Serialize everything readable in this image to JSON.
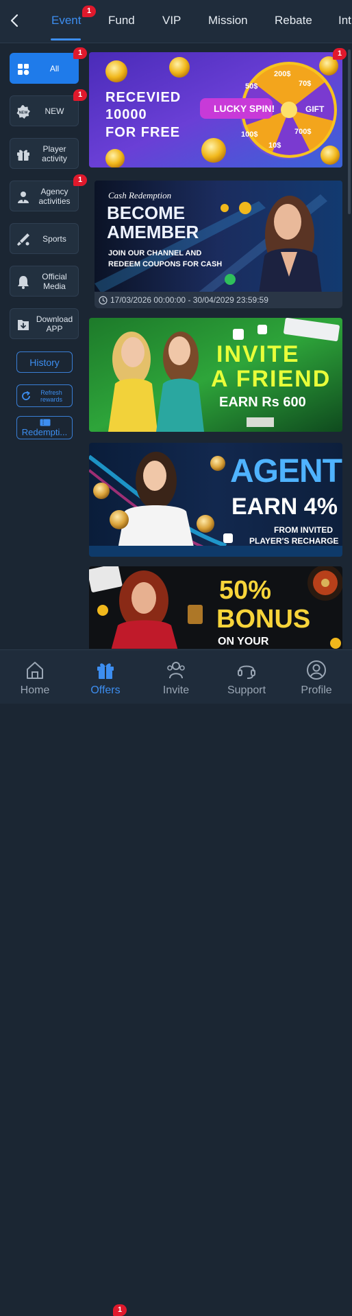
{
  "header": {
    "back_icon": "chevron-left-icon",
    "tabs": [
      {
        "label": "Event",
        "active": true,
        "badge": "1"
      },
      {
        "label": "Fund"
      },
      {
        "label": "VIP"
      },
      {
        "label": "Mission"
      },
      {
        "label": "Rebate"
      },
      {
        "label": "Int"
      }
    ]
  },
  "sidebar": {
    "items": [
      {
        "label": "All",
        "icon": "grid-icon",
        "active": true,
        "badge": "1"
      },
      {
        "label": "NEW",
        "icon": "new-icon",
        "badge": "1",
        "icon_text": "NEW"
      },
      {
        "label": "Player activity",
        "icon": "gift-icon"
      },
      {
        "label": "Agency activities",
        "icon": "agent-icon",
        "badge": "1"
      },
      {
        "label": "Sports",
        "icon": "sports-icon"
      },
      {
        "label": "Official Media",
        "icon": "bell-icon"
      },
      {
        "label": "Download APP",
        "icon": "download-icon"
      }
    ],
    "history_label": "History",
    "refresh_label": "Refresh rewards",
    "redemption_label": "Redempti..."
  },
  "banners": {
    "spin": {
      "badge": "1",
      "line1": "RECEVIED",
      "line2": "10000",
      "line3": "FOR FREE",
      "center_label": "LUCKY SPIN!",
      "wheel_labels": [
        "200$",
        "70$",
        "GIFT",
        "700$",
        "10$",
        "100$",
        "50$"
      ]
    },
    "member": {
      "script": "Cash Redemption",
      "line1": "BECOME",
      "line2": "AMEMBER",
      "line3": "JOIN OUR CHANNEL AND",
      "line4": "REDEEM COUPONS FOR CASH",
      "date": "17/03/2026 00:00:00 - 30/04/2029 23:59:59"
    },
    "invite": {
      "line1": "INVITE",
      "line2": "A FRIEND",
      "line3": "EARN Rs 600"
    },
    "agent": {
      "line1": "AGENT",
      "line2": "EARN 4%",
      "line3": "FROM INVITED",
      "line4": "PLAYER'S RECHARGE"
    },
    "bonus": {
      "line1": "50%",
      "line2": "BONUS",
      "line3": "ON YOUR"
    }
  },
  "bottom_nav": [
    {
      "label": "Home",
      "icon": "home-icon"
    },
    {
      "label": "Offers",
      "icon": "gift-box-icon",
      "active": true,
      "badge": "1"
    },
    {
      "label": "Invite",
      "icon": "people-icon"
    },
    {
      "label": "Support",
      "icon": "headset-icon"
    },
    {
      "label": "Profile",
      "icon": "person-icon"
    }
  ],
  "colors": {
    "accent": "#3d8ef0",
    "badge": "#e0192c",
    "background": "#1b2633"
  }
}
